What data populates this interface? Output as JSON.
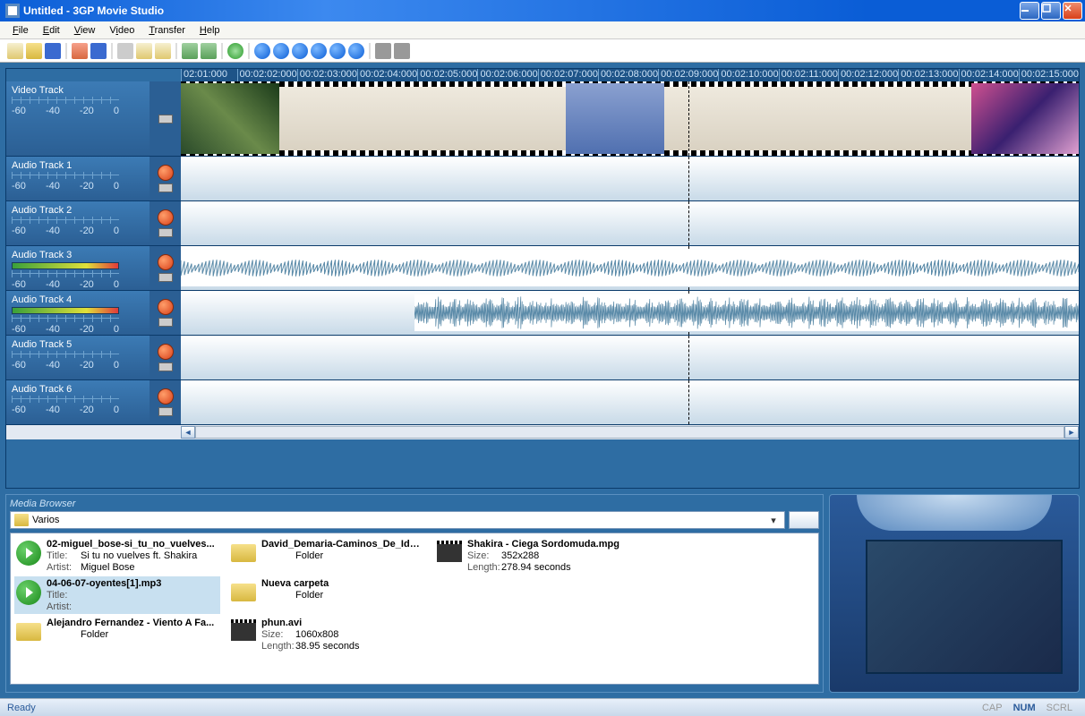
{
  "window": {
    "title": "Untitled - 3GP Movie Studio"
  },
  "menu": [
    "File",
    "Edit",
    "View",
    "Video",
    "Transfer",
    "Help"
  ],
  "timeline": {
    "ticks": [
      "02:01:000",
      "00:02:02:000",
      "00:02:03:000",
      "00:02:04:000",
      "00:02:05:000",
      "00:02:06:000",
      "00:02:07:000",
      "00:02:08:000",
      "00:02:09:000",
      "00:02:10:000",
      "00:02:11:000",
      "00:02:12:000",
      "00:02:13:000",
      "00:02:14:000",
      "00:02:15:000"
    ],
    "playhead_position_percent": 56.5,
    "video_track": {
      "name": "Video Track",
      "ruler": [
        "-60",
        "-40",
        "-20",
        "0"
      ]
    },
    "audio_tracks": [
      {
        "name": "Audio Track 1",
        "ruler": [
          "-60",
          "-40",
          "-20",
          "0"
        ],
        "has_meter": false
      },
      {
        "name": "Audio Track 2",
        "ruler": [
          "-60",
          "-40",
          "-20",
          "0"
        ],
        "has_meter": false
      },
      {
        "name": "Audio Track 3",
        "ruler": [
          "-60",
          "-40",
          "-20",
          "0"
        ],
        "has_meter": true,
        "waveform": {
          "left_percent": 0,
          "right_percent": 100
        }
      },
      {
        "name": "Audio Track 4",
        "ruler": [
          "-60",
          "-40",
          "-20",
          "0"
        ],
        "has_meter": true,
        "waveform": {
          "left_percent": 26,
          "right_percent": 100
        }
      },
      {
        "name": "Audio Track 5",
        "ruler": [
          "-60",
          "-40",
          "-20",
          "0"
        ],
        "has_meter": false
      },
      {
        "name": "Audio Track 6",
        "ruler": [
          "-60",
          "-40",
          "-20",
          "0"
        ],
        "has_meter": false
      }
    ]
  },
  "media_browser": {
    "title": "Media Browser",
    "path": "Varios",
    "items": [
      {
        "icon": "play",
        "name": "02-miguel_bose-si_tu_no_vuelves...",
        "line1_label": "Title:",
        "line1": "Si tu no vuelves ft. Shakira",
        "line2_label": "Artist:",
        "line2": "Miguel Bose"
      },
      {
        "icon": "folder",
        "name": "David_Demaria-Caminos_De_Ida_Y...",
        "line1_label": "",
        "line1": "Folder",
        "line2_label": "",
        "line2": ""
      },
      {
        "icon": "video",
        "name": "Shakira - Ciega Sordomuda.mpg",
        "line1_label": "Size:",
        "line1": "352x288",
        "line2_label": "Length:",
        "line2": "278.94 seconds"
      },
      {
        "icon": "play",
        "name": "04-06-07-oyentes[1].mp3",
        "line1_label": "Title:",
        "line1": "",
        "line2_label": "Artist:",
        "line2": "",
        "selected": true
      },
      {
        "icon": "folder",
        "name": "Nueva carpeta",
        "line1_label": "",
        "line1": "Folder",
        "line2_label": "",
        "line2": ""
      },
      null,
      {
        "icon": "folder",
        "name": "Alejandro Fernandez - Viento A Fa...",
        "line1_label": "",
        "line1": "Folder",
        "line2_label": "",
        "line2": ""
      },
      {
        "icon": "video",
        "name": "phun.avi",
        "line1_label": "Size:",
        "line1": "1060x808",
        "line2_label": "Length:",
        "line2": "38.95 seconds"
      }
    ]
  },
  "status": {
    "left": "Ready",
    "cap": "CAP",
    "num": "NUM",
    "scrl": "SCRL"
  }
}
